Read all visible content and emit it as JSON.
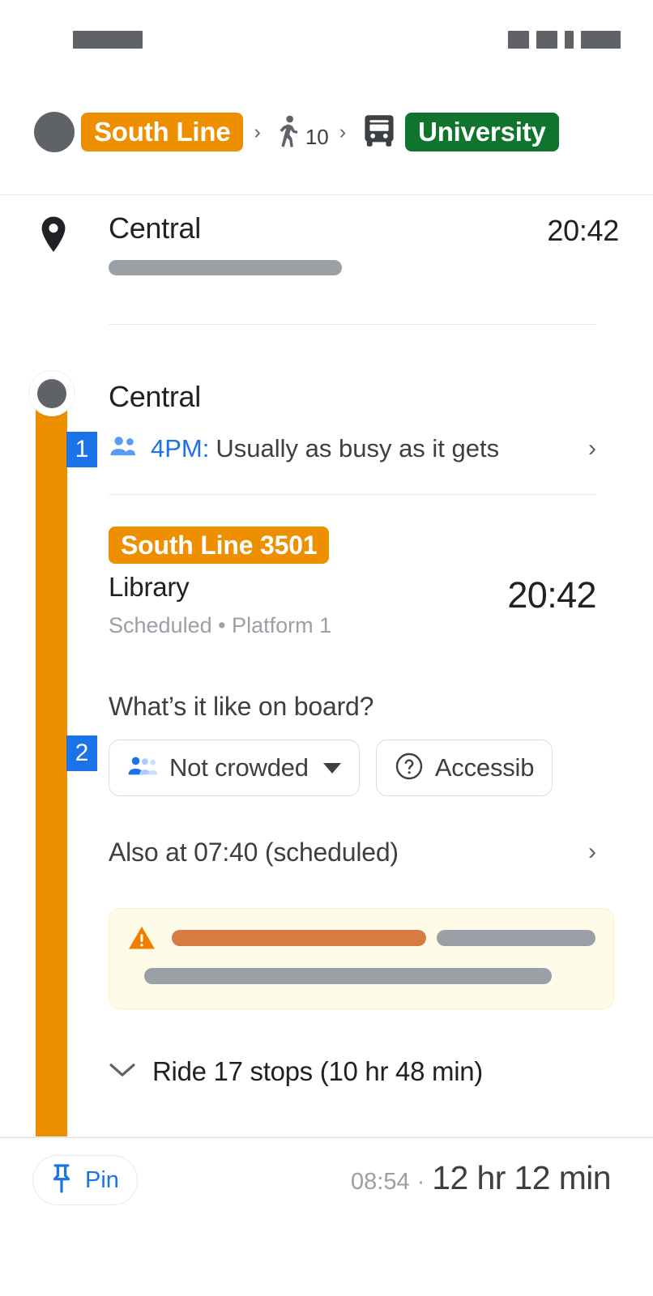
{
  "statusbar": {
    "left_block": "redacted",
    "right_blocks": [
      "redacted",
      "redacted",
      "redacted",
      "redacted"
    ]
  },
  "route_header": {
    "mode_icon": "transit-dot-icon",
    "first_line": "South Line",
    "first_line_color": "#EE8F00",
    "separator": "›",
    "walk_icon": "walking-person-icon",
    "walk_minutes": "10",
    "bus_icon": "bus-icon",
    "second_line": "University",
    "second_line_color": "#11742E"
  },
  "depart": {
    "pin_icon": "location-pin-icon",
    "name": "Central",
    "time": "20:42",
    "subtitle_redacted": true
  },
  "leg": {
    "step1_number": "1",
    "step2_number": "2",
    "timeline_color": "#EE8F00",
    "stop_name": "Central",
    "busy": {
      "icon": "people-icon",
      "time_label": "4PM:",
      "text": "Usually as busy as it gets",
      "chevron": "›",
      "accent_color": "#1A73E8"
    },
    "line_badge": "South Line 3501",
    "destination": "Library",
    "meta": "Scheduled • Platform 1",
    "departure_time": "20:42",
    "onboard_question": "What’s it like on board?",
    "chips": [
      {
        "icon": "crowding-people-icon",
        "label": "Not crowded",
        "has_caret": true
      },
      {
        "icon": "question-circle-icon",
        "label": "Accessib",
        "has_caret": false
      }
    ],
    "also_at": "Also at 07:40 (scheduled)",
    "also_chevron": "›",
    "alert": {
      "icon": "warning-triangle-icon",
      "background": "#FEFBE8",
      "redacted_lines": 3
    },
    "ride": {
      "caret": "∨",
      "text": "Ride 17 stops (10 hr 48 min)"
    }
  },
  "bottom_bar": {
    "pin_icon": "pushpin-icon",
    "pin_label": "Pin",
    "arrival_time": "08:54",
    "separator": "·",
    "duration": "12 hr 12 min"
  }
}
